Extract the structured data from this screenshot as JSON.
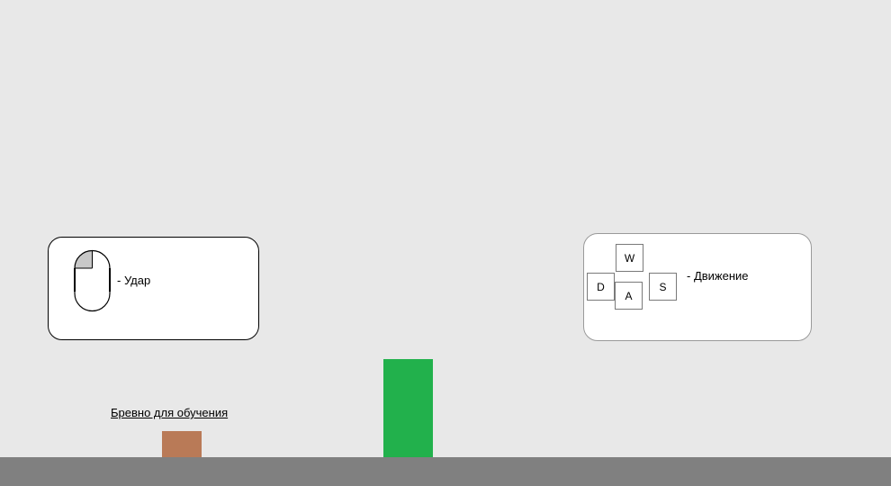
{
  "controls": {
    "attack": {
      "label": "- Удар",
      "icon": "mouse-left-click-icon"
    },
    "movement": {
      "label": "- Движение",
      "keys": {
        "w": "W",
        "d": "D",
        "a": "A",
        "s": "S"
      }
    }
  },
  "scene": {
    "training_log_label": "Бревно для обучения"
  },
  "colors": {
    "background": "#e8e8e8",
    "ground": "#808080",
    "player": "#22b14c",
    "training_log": "#b97a57",
    "panel": "#ffffff"
  }
}
